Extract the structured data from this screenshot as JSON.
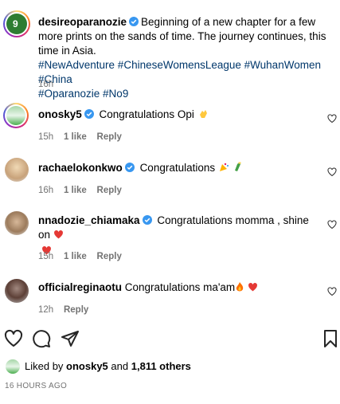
{
  "post": {
    "author": "desireoparanozie",
    "caption_text": "Beginning of a new chapter for a few more prints on the sands of time. The journey continues, this time in Asia.",
    "hashtags_line1": "#NewAdventure #ChineseWomensLeague #WuhanWomen #China",
    "hashtags_line2": "#Oparanozie #No9",
    "time": "16h"
  },
  "comments": [
    {
      "user": "onosky5",
      "text": "Congratulations Opi",
      "emoji": "clap",
      "time": "15h",
      "likes": "1 like",
      "reply": "Reply"
    },
    {
      "user": "rachaelokonkwo",
      "text": "Congratulations",
      "emoji": "party-champagne",
      "time": "16h",
      "likes": "1 like",
      "reply": "Reply"
    },
    {
      "user": "nnadozie_chiamaka",
      "text": "Congratulations momma , shine on",
      "emoji": "hearts",
      "time": "15h",
      "likes": "1 like",
      "reply": "Reply"
    },
    {
      "user": "officialreginaotu",
      "text": "Congratulations ma'am",
      "emoji": "fire-heart",
      "time": "12h",
      "likes": "",
      "reply": "Reply"
    }
  ],
  "likes": {
    "prefix": "Liked by",
    "user": "onosky5",
    "middle": "and",
    "count": "1,811 others"
  },
  "timestamp": "16 HOURS AGO",
  "colors": {
    "hashtag": "#00376b",
    "muted": "#737373",
    "verified": "#3897f0",
    "heart": "#ed4956"
  }
}
